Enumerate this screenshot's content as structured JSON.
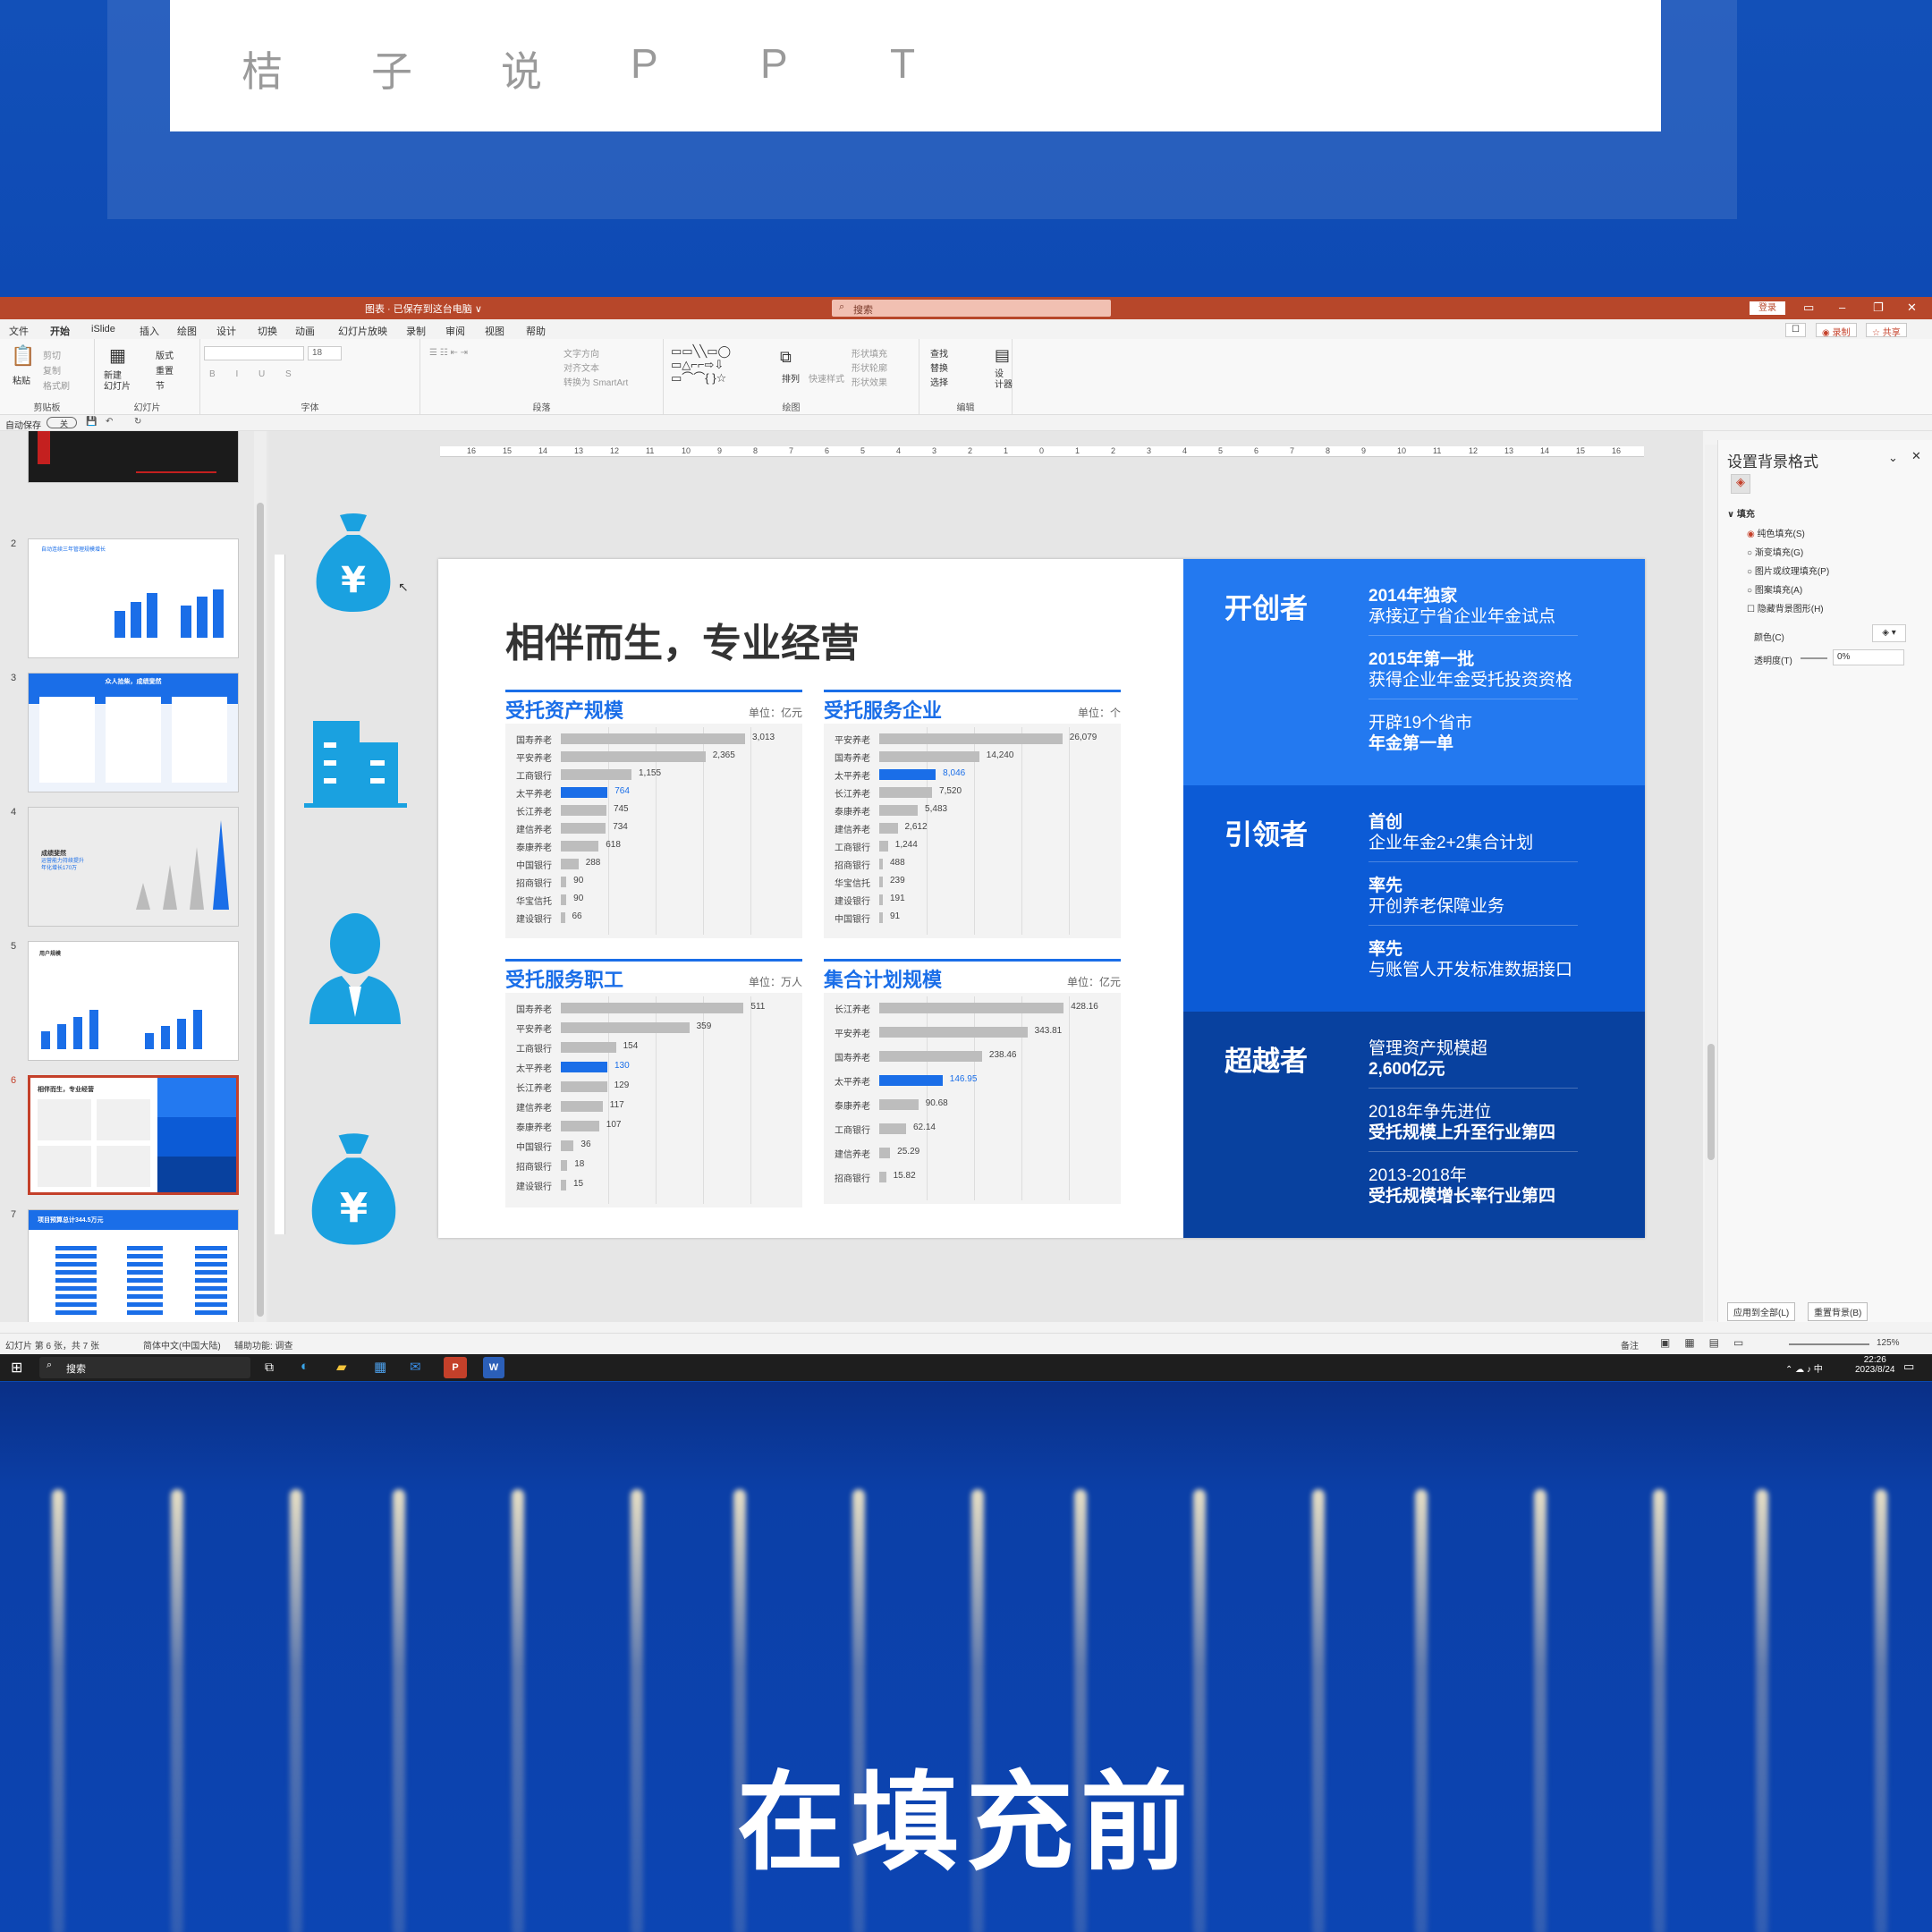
{
  "brand": {
    "chars": [
      "桔",
      "子",
      "说",
      "P",
      "P",
      "T"
    ]
  },
  "caption": "在填充前",
  "app": {
    "title": "图表 · 已保存到这台电脑 ∨",
    "search_placeholder": "搜索",
    "login": "登录",
    "menu": [
      "文件",
      "开始",
      "iSlide",
      "插入",
      "绘图",
      "设计",
      "切换",
      "动画",
      "幻灯片放映",
      "录制",
      "审阅",
      "视图",
      "帮助"
    ],
    "active_menu": "开始",
    "record_btn": "◉ 录制",
    "share_btn": "☆ 共享",
    "ribbon_groups": [
      "剪贴板",
      "幻灯片",
      "字体",
      "段落",
      "绘图",
      "编辑"
    ],
    "ribbon": {
      "paste": "粘贴",
      "cut": "剪切",
      "copy": "复制",
      "format_painter": "格式刷",
      "new_slide": "新建\n幻灯片",
      "layout": "版式",
      "reset": "重置",
      "section": "节",
      "font_size": "18",
      "text_direction": "文字方向",
      "align_text": "对齐文本",
      "smartart": "转换为 SmartArt",
      "arrange": "排列",
      "quick_styles": "快速样式",
      "shape_fill": "形状填充",
      "shape_outline": "形状轮廓",
      "shape_effects": "形状效果",
      "find": "查找",
      "replace": "替换",
      "select": "选择",
      "designer": "设\n计器"
    },
    "autosave": "自动保存",
    "autosave_state": "关"
  },
  "thumbnails": {
    "numbers": [
      "2",
      "3",
      "4",
      "5",
      "6",
      "7"
    ],
    "selected": "6",
    "t2_title": "自动连续三年管理规模增长",
    "t3_title": "众人拾柴，成绩斐然",
    "t4_title": "成绩斐然",
    "t4_sub": "运营能力持续提升\n年化增长170万",
    "t5_title": "用户规模",
    "t6_title": "相伴而生，专业经营",
    "t7_title": "项目预算总计344.5万元"
  },
  "slide": {
    "title": "相伴而生，专业经营",
    "panels": [
      {
        "title": "受托资产规模",
        "unit": "单位：亿元",
        "max": 3100,
        "labels": [
          "国寿养老",
          "平安养老",
          "工商银行",
          "太平养老",
          "长江养老",
          "建信养老",
          "泰康养老",
          "中国银行",
          "招商银行",
          "华宝信托",
          "建设银行"
        ],
        "values": [
          3013,
          2365,
          1155,
          764,
          745,
          734,
          618,
          288,
          90,
          90,
          66
        ],
        "display": [
          "3,013",
          "2,365",
          "1,155",
          "764",
          "745",
          "734",
          "618",
          "288",
          "90",
          "90",
          "66"
        ],
        "highlight": 3
      },
      {
        "title": "受托服务企业",
        "unit": "单位：个",
        "max": 27000,
        "labels": [
          "平安养老",
          "国寿养老",
          "太平养老",
          "长江养老",
          "泰康养老",
          "建信养老",
          "工商银行",
          "招商银行",
          "华宝信托",
          "建设银行",
          "中国银行"
        ],
        "values": [
          26079,
          14240,
          8046,
          7520,
          5483,
          2612,
          1244,
          488,
          239,
          191,
          91
        ],
        "display": [
          "26,079",
          "14,240",
          "8,046",
          "7,520",
          "5,483",
          "2,612",
          "1,244",
          "488",
          "239",
          "191",
          "91"
        ],
        "highlight": 2
      },
      {
        "title": "受托服务职工",
        "unit": "单位：万人",
        "max": 530,
        "labels": [
          "国寿养老",
          "平安养老",
          "工商银行",
          "太平养老",
          "长江养老",
          "建信养老",
          "泰康养老",
          "中国银行",
          "招商银行",
          "建设银行"
        ],
        "values": [
          511,
          359,
          154,
          130,
          129,
          117,
          107,
          36,
          18,
          15
        ],
        "display": [
          "511",
          "359",
          "154",
          "130",
          "129",
          "117",
          "107",
          "36",
          "18",
          "15"
        ],
        "highlight": 3
      },
      {
        "title": "集合计划规模",
        "unit": "单位：亿元",
        "max": 440,
        "labels": [
          "长江养老",
          "平安养老",
          "国寿养老",
          "太平养老",
          "泰康养老",
          "工商银行",
          "建信养老",
          "招商银行"
        ],
        "values": [
          428.16,
          343.81,
          238.46,
          146.95,
          90.68,
          62.14,
          25.29,
          15.82
        ],
        "display": [
          "428.16",
          "343.81",
          "238.46",
          "146.95",
          "90.68",
          "62.14",
          "25.29",
          "15.82"
        ],
        "highlight": 3
      }
    ],
    "blocks": [
      {
        "head": "开创者",
        "color": "#2379f0",
        "items": [
          {
            "l1": "2014年独家",
            "l2": "承接辽宁省企业年金试点",
            "bold": 1
          },
          {
            "l1": "2015年第一批",
            "l2": "获得企业年金受托投资资格",
            "bold": 1
          },
          {
            "l1": "开辟19个省市",
            "l2": "年金第一单",
            "bold": 2
          }
        ]
      },
      {
        "head": "引领者",
        "color": "#0c5bd6",
        "items": [
          {
            "l1": "首创",
            "l2": "企业年金2+2集合计划",
            "bold": 1
          },
          {
            "l1": "率先",
            "l2": "开创养老保障业务",
            "bold": 1
          },
          {
            "l1": "率先",
            "l2": "与账管人开发标准数据接口",
            "bold": 1
          }
        ]
      },
      {
        "head": "超越者",
        "color": "#08419f",
        "items": [
          {
            "l1": "管理资产规模超",
            "l2": "2,600亿元",
            "bold": 2
          },
          {
            "l1": "2018年争先进位",
            "l2": "受托规模上升至行业第四",
            "bold": 2
          },
          {
            "l1": "2013-2018年",
            "l2": "受托规模增长率行业第四",
            "bold": 2
          }
        ]
      }
    ]
  },
  "pane": {
    "title": "设置背景格式",
    "section": "填充",
    "options": [
      "纯色填充(S)",
      "渐变填充(G)",
      "图片或纹理填充(P)",
      "图案填充(A)"
    ],
    "hide_bg": "隐藏背景图形(H)",
    "color_label": "颜色(C)",
    "transparency_label": "透明度(T)",
    "transparency_value": "0%",
    "apply_all": "应用到全部(L)",
    "reset_bg": "重置背景(B)"
  },
  "status": {
    "slide": "幻灯片 第 6 张，共 7 张",
    "lang": "简体中文(中国大陆)",
    "accessibility": "辅助功能: 调查",
    "notes": "备注",
    "zoom": "125%"
  },
  "taskbar": {
    "search": "搜索",
    "time": "22:26",
    "date": "2023/8/24"
  },
  "colors": {
    "accent": "#1a6ee8",
    "title_bar": "#b7472a"
  }
}
